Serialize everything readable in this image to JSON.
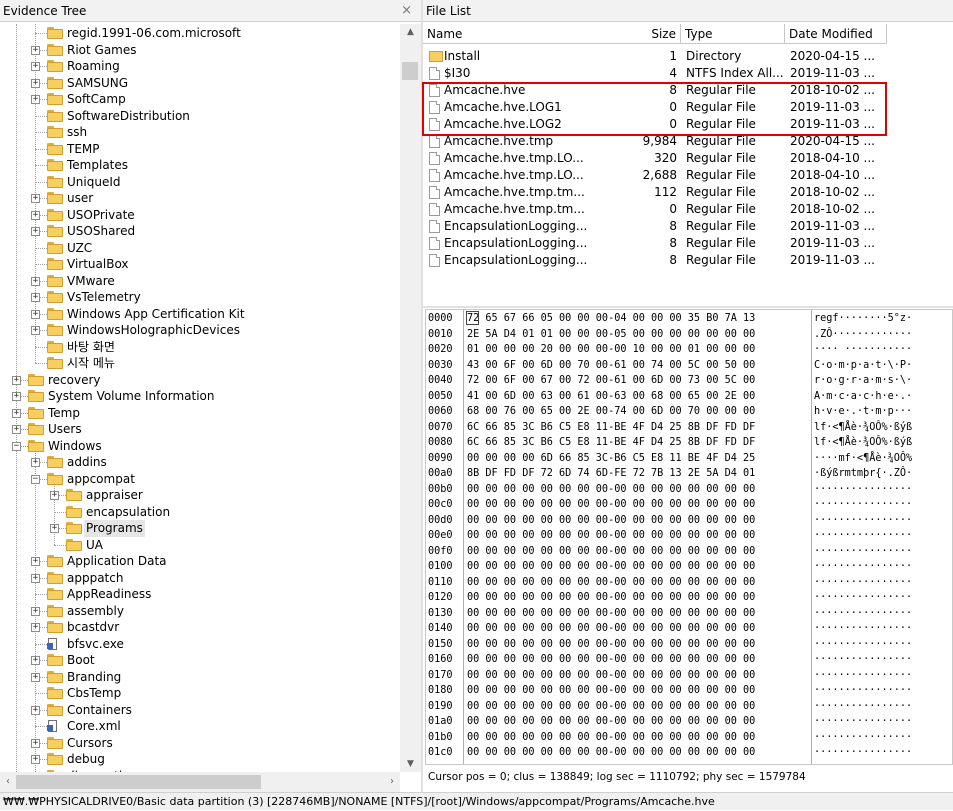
{
  "evidence_tree": {
    "title": "Evidence Tree",
    "close_glyph": "×",
    "items": [
      {
        "label": "regid.1991-06.com.microsoft",
        "depth": 4,
        "expander": false
      },
      {
        "label": "Riot Games",
        "depth": 4,
        "expander": true
      },
      {
        "label": "Roaming",
        "depth": 4,
        "expander": true
      },
      {
        "label": "SAMSUNG",
        "depth": 4,
        "expander": true
      },
      {
        "label": "SoftCamp",
        "depth": 4,
        "expander": true
      },
      {
        "label": "SoftwareDistribution",
        "depth": 4,
        "expander": false
      },
      {
        "label": "ssh",
        "depth": 4,
        "expander": false
      },
      {
        "label": "TEMP",
        "depth": 4,
        "expander": false
      },
      {
        "label": "Templates",
        "depth": 4,
        "expander": false
      },
      {
        "label": "UniqueId",
        "depth": 4,
        "expander": false
      },
      {
        "label": "user",
        "depth": 4,
        "expander": true
      },
      {
        "label": "USOPrivate",
        "depth": 4,
        "expander": true
      },
      {
        "label": "USOShared",
        "depth": 4,
        "expander": true
      },
      {
        "label": "UZC",
        "depth": 4,
        "expander": false
      },
      {
        "label": "VirtualBox",
        "depth": 4,
        "expander": false
      },
      {
        "label": "VMware",
        "depth": 4,
        "expander": true
      },
      {
        "label": "VsTelemetry",
        "depth": 4,
        "expander": true
      },
      {
        "label": "Windows App Certification Kit",
        "depth": 4,
        "expander": true
      },
      {
        "label": "WindowsHolographicDevices",
        "depth": 4,
        "expander": true
      },
      {
        "label": "바탕 화면",
        "depth": 4,
        "expander": false
      },
      {
        "label": "시작 메뉴",
        "depth": 4,
        "expander": false
      },
      {
        "label": "recovery",
        "depth": 3,
        "expander": true
      },
      {
        "label": "System Volume Information",
        "depth": 3,
        "expander": true
      },
      {
        "label": "Temp",
        "depth": 3,
        "expander": true
      },
      {
        "label": "Users",
        "depth": 3,
        "expander": true
      },
      {
        "label": "Windows",
        "depth": 3,
        "expander": true,
        "expanded": true
      },
      {
        "label": "addins",
        "depth": 4,
        "expander": true
      },
      {
        "label": "appcompat",
        "depth": 4,
        "expander": true,
        "expanded": true
      },
      {
        "label": "appraiser",
        "depth": 5,
        "expander": true
      },
      {
        "label": "encapsulation",
        "depth": 5,
        "expander": false
      },
      {
        "label": "Programs",
        "depth": 5,
        "expander": true,
        "selected": true
      },
      {
        "label": "UA",
        "depth": 5,
        "expander": false
      },
      {
        "label": "Application Data",
        "depth": 4,
        "expander": true
      },
      {
        "label": "apppatch",
        "depth": 4,
        "expander": true
      },
      {
        "label": "AppReadiness",
        "depth": 4,
        "expander": false
      },
      {
        "label": "assembly",
        "depth": 4,
        "expander": true
      },
      {
        "label": "bcastdvr",
        "depth": 4,
        "expander": true
      },
      {
        "label": "bfsvc.exe",
        "depth": 4,
        "expander": false,
        "file": true
      },
      {
        "label": "Boot",
        "depth": 4,
        "expander": true
      },
      {
        "label": "Branding",
        "depth": 4,
        "expander": true
      },
      {
        "label": "CbsTemp",
        "depth": 4,
        "expander": false
      },
      {
        "label": "Containers",
        "depth": 4,
        "expander": true
      },
      {
        "label": "Core.xml",
        "depth": 4,
        "expander": false,
        "file": true
      },
      {
        "label": "Cursors",
        "depth": 4,
        "expander": true
      },
      {
        "label": "debug",
        "depth": 4,
        "expander": true
      },
      {
        "label": "diagnostics",
        "depth": 4,
        "expander": true
      }
    ]
  },
  "file_list": {
    "title": "File List",
    "columns": {
      "name": "Name",
      "size": "Size",
      "type": "Type",
      "date": "Date Modified"
    },
    "rows": [
      {
        "name": "Install",
        "size": "1",
        "type": "Directory",
        "date": "2020-04-15 ...",
        "icon": "folder-icon"
      },
      {
        "name": "$I30",
        "size": "4",
        "type": "NTFS Index All...",
        "date": "2019-11-03 ...",
        "icon": "file-icon"
      },
      {
        "name": "Amcache.hve",
        "size": "8",
        "type": "Regular File",
        "date": "2018-10-02 ...",
        "icon": "file-icon"
      },
      {
        "name": "Amcache.hve.LOG1",
        "size": "0",
        "type": "Regular File",
        "date": "2019-11-03 ...",
        "icon": "file-icon"
      },
      {
        "name": "Amcache.hve.LOG2",
        "size": "0",
        "type": "Regular File",
        "date": "2019-11-03 ...",
        "icon": "file-icon"
      },
      {
        "name": "Amcache.hve.tmp",
        "size": "9,984",
        "type": "Regular File",
        "date": "2020-04-15 ...",
        "icon": "file-icon"
      },
      {
        "name": "Amcache.hve.tmp.LO...",
        "size": "320",
        "type": "Regular File",
        "date": "2018-04-10 ...",
        "icon": "file-icon"
      },
      {
        "name": "Amcache.hve.tmp.LO...",
        "size": "2,688",
        "type": "Regular File",
        "date": "2018-04-10 ...",
        "icon": "file-icon"
      },
      {
        "name": "Amcache.hve.tmp.tm...",
        "size": "112",
        "type": "Regular File",
        "date": "2018-10-02 ...",
        "icon": "file-icon"
      },
      {
        "name": "Amcache.hve.tmp.tm...",
        "size": "0",
        "type": "Regular File",
        "date": "2018-10-02 ...",
        "icon": "file-icon"
      },
      {
        "name": "EncapsulationLogging...",
        "size": "8",
        "type": "Regular File",
        "date": "2019-11-03 ...",
        "icon": "file-icon"
      },
      {
        "name": "EncapsulationLogging...",
        "size": "8",
        "type": "Regular File",
        "date": "2019-11-03 ...",
        "icon": "file-icon"
      },
      {
        "name": "EncapsulationLogging...",
        "size": "8",
        "type": "Regular File",
        "date": "2019-11-03 ...",
        "icon": "file-icon"
      }
    ],
    "highlight_color": "#e00000"
  },
  "hex_view": {
    "rows": [
      {
        "off": "0000",
        "bytes": "72 65 67 66 05 00 00 00-04 00 00 00 35 B0 7A 13",
        "ascii": "regf········5°z·"
      },
      {
        "off": "0010",
        "bytes": "2E 5A D4 01 01 00 00 00-05 00 00 00 00 00 00 00",
        "ascii": ".ZÔ·············"
      },
      {
        "off": "0020",
        "bytes": "01 00 00 00 20 00 00 00-00 10 00 00 01 00 00 00",
        "ascii": "···· ···········"
      },
      {
        "off": "0030",
        "bytes": "43 00 6F 00 6D 00 70 00-61 00 74 00 5C 00 50 00",
        "ascii": "C·o·m·p·a·t·\\·P·"
      },
      {
        "off": "0040",
        "bytes": "72 00 6F 00 67 00 72 00-61 00 6D 00 73 00 5C 00",
        "ascii": "r·o·g·r·a·m·s·\\·"
      },
      {
        "off": "0050",
        "bytes": "41 00 6D 00 63 00 61 00-63 00 68 00 65 00 2E 00",
        "ascii": "A·m·c·a·c·h·e·.·"
      },
      {
        "off": "0060",
        "bytes": "68 00 76 00 65 00 2E 00-74 00 6D 00 70 00 00 00",
        "ascii": "h·v·e·.·t·m·p···"
      },
      {
        "off": "0070",
        "bytes": "6C 66 85 3C B6 C5 E8 11-BE 4F D4 25 8B DF FD DF",
        "ascii": "lf·<¶Åè·¾OÔ%·ßýß"
      },
      {
        "off": "0080",
        "bytes": "6C 66 85 3C B6 C5 E8 11-BE 4F D4 25 8B DF FD DF",
        "ascii": "lf·<¶Åè·¾OÔ%·ßýß"
      },
      {
        "off": "0090",
        "bytes": "00 00 00 00 6D 66 85 3C-B6 C5 E8 11 BE 4F D4 25",
        "ascii": "····mf·<¶Åè·¾OÔ%"
      },
      {
        "off": "00a0",
        "bytes": "8B DF FD DF 72 6D 74 6D-FE 72 7B 13 2E 5A D4 01",
        "ascii": "·ßýßrmtmþr{·.ZÔ·"
      },
      {
        "off": "00b0",
        "bytes": "00 00 00 00 00 00 00 00-00 00 00 00 00 00 00 00",
        "ascii": "················"
      },
      {
        "off": "00c0",
        "bytes": "00 00 00 00 00 00 00 00-00 00 00 00 00 00 00 00",
        "ascii": "················"
      },
      {
        "off": "00d0",
        "bytes": "00 00 00 00 00 00 00 00-00 00 00 00 00 00 00 00",
        "ascii": "················"
      },
      {
        "off": "00e0",
        "bytes": "00 00 00 00 00 00 00 00-00 00 00 00 00 00 00 00",
        "ascii": "················"
      },
      {
        "off": "00f0",
        "bytes": "00 00 00 00 00 00 00 00-00 00 00 00 00 00 00 00",
        "ascii": "················"
      },
      {
        "off": "0100",
        "bytes": "00 00 00 00 00 00 00 00-00 00 00 00 00 00 00 00",
        "ascii": "················"
      },
      {
        "off": "0110",
        "bytes": "00 00 00 00 00 00 00 00-00 00 00 00 00 00 00 00",
        "ascii": "················"
      },
      {
        "off": "0120",
        "bytes": "00 00 00 00 00 00 00 00-00 00 00 00 00 00 00 00",
        "ascii": "················"
      },
      {
        "off": "0130",
        "bytes": "00 00 00 00 00 00 00 00-00 00 00 00 00 00 00 00",
        "ascii": "················"
      },
      {
        "off": "0140",
        "bytes": "00 00 00 00 00 00 00 00-00 00 00 00 00 00 00 00",
        "ascii": "················"
      },
      {
        "off": "0150",
        "bytes": "00 00 00 00 00 00 00 00-00 00 00 00 00 00 00 00",
        "ascii": "················"
      },
      {
        "off": "0160",
        "bytes": "00 00 00 00 00 00 00 00-00 00 00 00 00 00 00 00",
        "ascii": "················"
      },
      {
        "off": "0170",
        "bytes": "00 00 00 00 00 00 00 00-00 00 00 00 00 00 00 00",
        "ascii": "················"
      },
      {
        "off": "0180",
        "bytes": "00 00 00 00 00 00 00 00-00 00 00 00 00 00 00 00",
        "ascii": "················"
      },
      {
        "off": "0190",
        "bytes": "00 00 00 00 00 00 00 00-00 00 00 00 00 00 00 00",
        "ascii": "················"
      },
      {
        "off": "01a0",
        "bytes": "00 00 00 00 00 00 00 00-00 00 00 00 00 00 00 00",
        "ascii": "················"
      },
      {
        "off": "01b0",
        "bytes": "00 00 00 00 00 00 00 00-00 00 00 00 00 00 00 00",
        "ascii": "················"
      },
      {
        "off": "01c0",
        "bytes": "00 00 00 00 00 00 00 00-00 00 00 00 00 00 00 00",
        "ascii": "················"
      }
    ],
    "cursor_status": "Cursor pos = 0; clus = 138849; log sec = 1110792; phy sec = 1579784"
  },
  "status_bar": {
    "path": "₩₩.₩PHYSICALDRIVE0/Basic data partition (3) [228746MB]/NONAME [NTFS]/[root]/Windows/appcompat/Programs/Amcache.hve"
  }
}
